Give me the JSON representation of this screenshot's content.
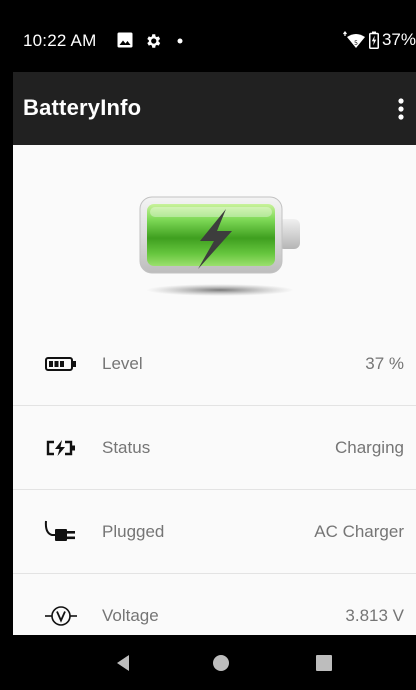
{
  "status_bar": {
    "time": "10:22 AM",
    "battery_percent_text": "37%",
    "icons": [
      "image-icon",
      "gear-icon",
      "dot-icon",
      "wifi-icon",
      "charging-battery-icon"
    ]
  },
  "app_bar": {
    "title": "BatteryInfo",
    "overflow_icon": "more-vert-icon"
  },
  "hero": {
    "icon": "battery-charging-illustration"
  },
  "rows": [
    {
      "id": "level",
      "icon": "battery-level-icon",
      "label": "Level",
      "value": "37 %"
    },
    {
      "id": "status",
      "icon": "battery-charging-status-icon",
      "label": "Status",
      "value": "Charging"
    },
    {
      "id": "plugged",
      "icon": "plug-icon",
      "label": "Plugged",
      "value": "AC Charger"
    },
    {
      "id": "voltage",
      "icon": "voltage-icon",
      "label": "Voltage",
      "value": "3.813 V"
    }
  ],
  "nav_bar": {
    "buttons": [
      "back-icon",
      "home-icon",
      "recents-icon"
    ]
  },
  "colors": {
    "app_bar": "#212121",
    "status_bar": "#000000",
    "background": "#fafafa",
    "text_secondary": "#757575",
    "battery_green": "#5fc63a"
  }
}
